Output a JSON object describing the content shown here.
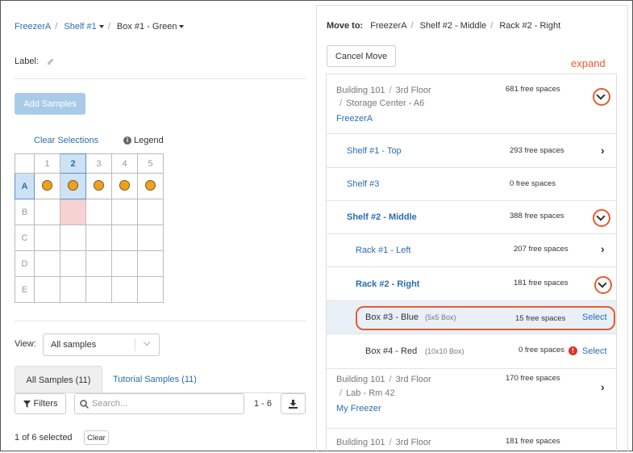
{
  "breadcrumb": {
    "freezer": "FreezerA",
    "shelf": "Shelf #1",
    "box": "Box #1 - Green"
  },
  "label": {
    "text": "Label:"
  },
  "add_samples": "Add Samples",
  "clear_selections": "Clear Selections",
  "legend": "Legend",
  "grid": {
    "cols": [
      "1",
      "2",
      "3",
      "4",
      "5"
    ],
    "rows": [
      "A",
      "B",
      "C",
      "D",
      "E"
    ],
    "selected_col": "2",
    "selected_row": "A"
  },
  "view": {
    "label": "View:",
    "value": "All samples"
  },
  "tabs": [
    "All Samples (11)",
    "Tutorial Samples (11)"
  ],
  "filters": "Filters",
  "search": {
    "placeholder": "Search..."
  },
  "paging": "1 - 6",
  "selected": {
    "text": "1 of 6 selected",
    "clear": "Clear"
  },
  "move_to": {
    "label": "Move to:",
    "path": [
      "FreezerA",
      "Shelf #2 - Middle",
      "Rack #2 - Right"
    ]
  },
  "cancel_move": "Cancel Move",
  "annotation": "expand",
  "locations": [
    {
      "path1": "Building 101",
      "path2": "3rd Floor",
      "path3": "Storage Center - A6",
      "name": "FreezerA",
      "free": "681 free spaces"
    },
    {
      "name": "Shelf #1 - Top",
      "free": "293 free spaces"
    },
    {
      "name": "Shelf #3",
      "free": "0 free spaces"
    },
    {
      "name": "Shelf #2 - Middle",
      "free": "388 free spaces"
    },
    {
      "name": "Rack #1 - Left",
      "free": "207 free spaces"
    },
    {
      "name": "Rack #2 - Right",
      "free": "181 free spaces"
    },
    {
      "name": "Box #3 - Blue",
      "type": "(5x5 Box)",
      "free": "15 free spaces",
      "action": "Select"
    },
    {
      "name": "Box #4 - Red",
      "type": "(10x10 Box)",
      "free": "0 free spaces",
      "action": "Select"
    },
    {
      "path1": "Building 101",
      "path2": "3rd Floor",
      "path3": "Lab - Rm 42",
      "name": "My Freezer",
      "free": "170 free spaces"
    },
    {
      "path1": "Building 101",
      "path2": "3rd Floor",
      "free": "181 free spaces"
    }
  ],
  "colors": {
    "link": "#2a6db0",
    "highlight": "#e35c2c",
    "sample": "#f0a020"
  }
}
